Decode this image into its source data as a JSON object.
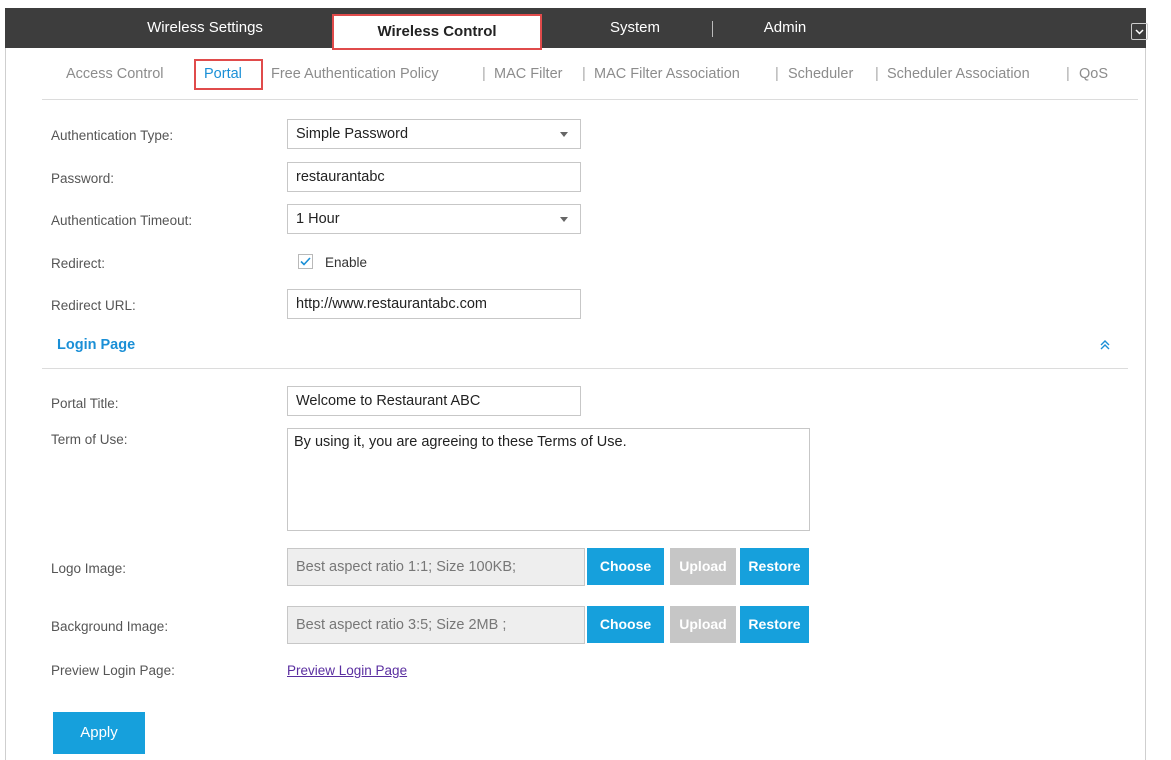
{
  "tabs": [
    {
      "label": "Wireless Settings"
    },
    {
      "label": "Wireless Control"
    },
    {
      "label": "System"
    },
    {
      "label": "Admin"
    }
  ],
  "subnav": {
    "items": [
      "Access Control",
      "Portal",
      "Free Authentication Policy",
      "MAC Filter",
      "MAC Filter Association",
      "Scheduler",
      "Scheduler Association",
      "QoS"
    ],
    "separator": "|",
    "active": "Portal"
  },
  "form": {
    "auth_type_label": "Authentication Type:",
    "auth_type_value": "Simple Password",
    "password_label": "Password:",
    "password_value": "restaurantabc",
    "timeout_label": "Authentication Timeout:",
    "timeout_value": "1 Hour",
    "redirect_label": "Redirect:",
    "redirect_checked": true,
    "redirect_enable_label": "Enable",
    "redirect_url_label": "Redirect URL:",
    "redirect_url_value": "http://www.restaurantabc.com"
  },
  "login_page": {
    "title": "Login Page",
    "portal_title_label": "Portal Title:",
    "portal_title_value": "Welcome to Restaurant ABC",
    "terms_label": "Term of Use:",
    "terms_value": "By using it, you are agreeing to these Terms of Use.",
    "logo_label": "Logo Image:",
    "logo_hint": "Best aspect ratio 1:1; Size 100KB;",
    "background_label": "Background Image:",
    "background_hint": "Best aspect ratio 3:5; Size 2MB ;",
    "choose_label": "Choose",
    "upload_label": "Upload",
    "restore_label": "Restore",
    "preview_label": "Preview Login Page:",
    "preview_link": "Preview Login Page"
  },
  "apply_label": "Apply",
  "colors": {
    "accent": "#1a8fd6",
    "button": "#16a0dc",
    "highlight": "#e04b4b",
    "topbar": "#3d3d3d"
  }
}
